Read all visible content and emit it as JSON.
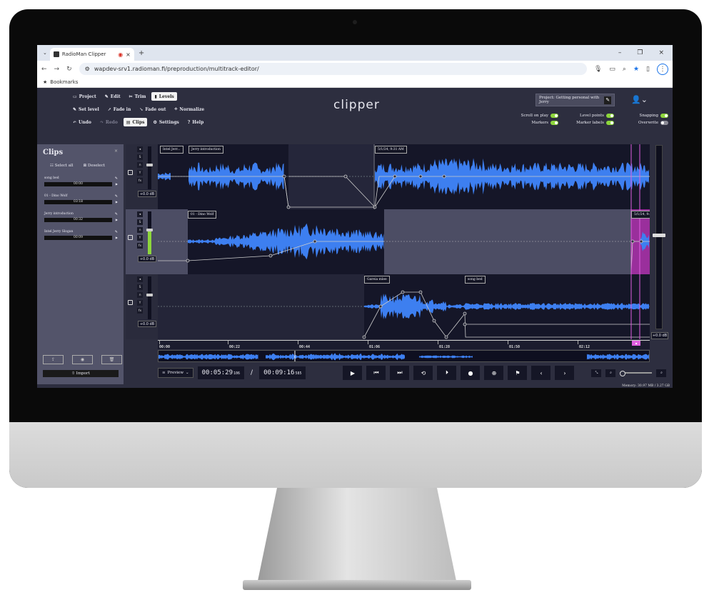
{
  "browser": {
    "tab_title": "RadioMan Clipper",
    "url": "wapdev-srv1.radioman.fi/preproduction/multitrack-editor/",
    "bookmarks_label": "Bookmarks"
  },
  "app": {
    "logo": "clipper",
    "toolbar_row1": [
      "Project",
      "Edit",
      "Trim",
      "Levels"
    ],
    "toolbar_row2": [
      "Set level",
      "Fade in",
      "Fade out",
      "Normalize"
    ],
    "toolbar_row3": [
      "Undo",
      "Redo",
      "Clips",
      "Settings",
      "Help"
    ],
    "project_label": "Project: Getting personal with Jerry",
    "toggles": [
      {
        "label": "Scroll on play",
        "on": true
      },
      {
        "label": "Level points",
        "on": true
      },
      {
        "label": "Snapping",
        "on": true
      },
      {
        "label": "Markers",
        "on": true
      },
      {
        "label": "Marker labels",
        "on": true
      },
      {
        "label": "Overwrite",
        "on": false
      }
    ]
  },
  "clips_panel": {
    "title": "Clips",
    "close": "×",
    "select_all": "Select all",
    "deselect": "Deselect",
    "items": [
      {
        "name": "song bed",
        "duration": "00:00"
      },
      {
        "name": "01 - Dino Wolf",
        "duration": "03:18"
      },
      {
        "name": "Jerry introduction",
        "duration": "00:32"
      },
      {
        "name": "Intel Jerry Slogan",
        "duration": "00:09"
      }
    ],
    "import_label": "Import"
  },
  "tracks": [
    {
      "db": "+0.0 dB",
      "clips": [
        "Intel Jerr...",
        "Jerry introduction",
        "5/1/24, 9:31 AM"
      ]
    },
    {
      "db": "+0.0 dB",
      "clips": [
        "01 - Dino Wolf",
        "5/1/24, 9:4"
      ]
    },
    {
      "db": "+0.0 dB",
      "clips": [
        "Gareia mlee",
        "song bed"
      ]
    }
  ],
  "master_db": "+0.0 dB",
  "ruler_ticks": [
    "00:00",
    "00:22",
    "00:44",
    "01:06",
    "01:28",
    "01:50",
    "02:12"
  ],
  "transport": {
    "preview_label": "Preview",
    "current_time": "00:05:29",
    "current_ms": "106",
    "total_time": "00:09:16",
    "total_ms": "585"
  },
  "memory_text": "Memory: 30.97 MB / 3.27 GB",
  "colors": {
    "waveform": "#3d7ff0",
    "accent_pink": "#e05fe0",
    "toggle_on": "#8dd63c"
  }
}
